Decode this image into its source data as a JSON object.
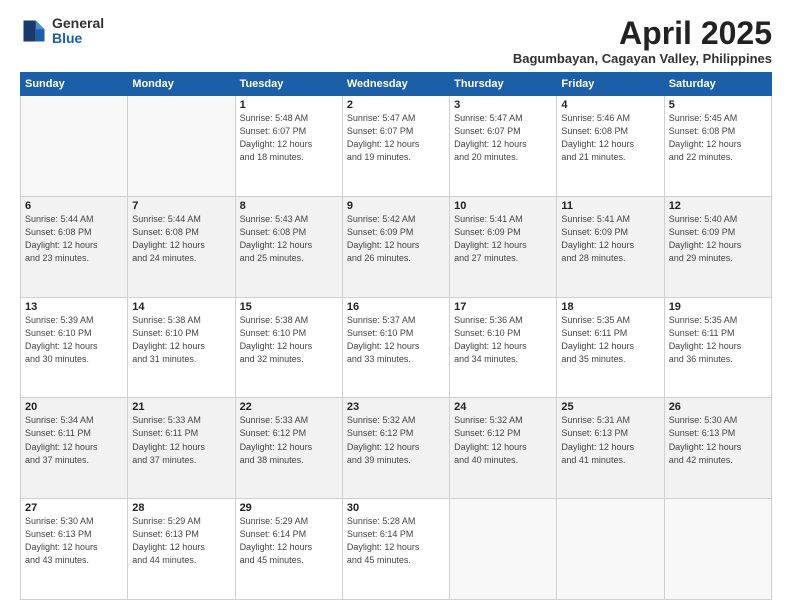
{
  "header": {
    "logo_general": "General",
    "logo_blue": "Blue",
    "main_title": "April 2025",
    "subtitle": "Bagumbayan, Cagayan Valley, Philippines"
  },
  "weekdays": [
    "Sunday",
    "Monday",
    "Tuesday",
    "Wednesday",
    "Thursday",
    "Friday",
    "Saturday"
  ],
  "weeks": [
    [
      {
        "day": "",
        "info": ""
      },
      {
        "day": "",
        "info": ""
      },
      {
        "day": "1",
        "info": "Sunrise: 5:48 AM\nSunset: 6:07 PM\nDaylight: 12 hours\nand 18 minutes."
      },
      {
        "day": "2",
        "info": "Sunrise: 5:47 AM\nSunset: 6:07 PM\nDaylight: 12 hours\nand 19 minutes."
      },
      {
        "day": "3",
        "info": "Sunrise: 5:47 AM\nSunset: 6:07 PM\nDaylight: 12 hours\nand 20 minutes."
      },
      {
        "day": "4",
        "info": "Sunrise: 5:46 AM\nSunset: 6:08 PM\nDaylight: 12 hours\nand 21 minutes."
      },
      {
        "day": "5",
        "info": "Sunrise: 5:45 AM\nSunset: 6:08 PM\nDaylight: 12 hours\nand 22 minutes."
      }
    ],
    [
      {
        "day": "6",
        "info": "Sunrise: 5:44 AM\nSunset: 6:08 PM\nDaylight: 12 hours\nand 23 minutes."
      },
      {
        "day": "7",
        "info": "Sunrise: 5:44 AM\nSunset: 6:08 PM\nDaylight: 12 hours\nand 24 minutes."
      },
      {
        "day": "8",
        "info": "Sunrise: 5:43 AM\nSunset: 6:08 PM\nDaylight: 12 hours\nand 25 minutes."
      },
      {
        "day": "9",
        "info": "Sunrise: 5:42 AM\nSunset: 6:09 PM\nDaylight: 12 hours\nand 26 minutes."
      },
      {
        "day": "10",
        "info": "Sunrise: 5:41 AM\nSunset: 6:09 PM\nDaylight: 12 hours\nand 27 minutes."
      },
      {
        "day": "11",
        "info": "Sunrise: 5:41 AM\nSunset: 6:09 PM\nDaylight: 12 hours\nand 28 minutes."
      },
      {
        "day": "12",
        "info": "Sunrise: 5:40 AM\nSunset: 6:09 PM\nDaylight: 12 hours\nand 29 minutes."
      }
    ],
    [
      {
        "day": "13",
        "info": "Sunrise: 5:39 AM\nSunset: 6:10 PM\nDaylight: 12 hours\nand 30 minutes."
      },
      {
        "day": "14",
        "info": "Sunrise: 5:38 AM\nSunset: 6:10 PM\nDaylight: 12 hours\nand 31 minutes."
      },
      {
        "day": "15",
        "info": "Sunrise: 5:38 AM\nSunset: 6:10 PM\nDaylight: 12 hours\nand 32 minutes."
      },
      {
        "day": "16",
        "info": "Sunrise: 5:37 AM\nSunset: 6:10 PM\nDaylight: 12 hours\nand 33 minutes."
      },
      {
        "day": "17",
        "info": "Sunrise: 5:36 AM\nSunset: 6:10 PM\nDaylight: 12 hours\nand 34 minutes."
      },
      {
        "day": "18",
        "info": "Sunrise: 5:35 AM\nSunset: 6:11 PM\nDaylight: 12 hours\nand 35 minutes."
      },
      {
        "day": "19",
        "info": "Sunrise: 5:35 AM\nSunset: 6:11 PM\nDaylight: 12 hours\nand 36 minutes."
      }
    ],
    [
      {
        "day": "20",
        "info": "Sunrise: 5:34 AM\nSunset: 6:11 PM\nDaylight: 12 hours\nand 37 minutes."
      },
      {
        "day": "21",
        "info": "Sunrise: 5:33 AM\nSunset: 6:11 PM\nDaylight: 12 hours\nand 37 minutes."
      },
      {
        "day": "22",
        "info": "Sunrise: 5:33 AM\nSunset: 6:12 PM\nDaylight: 12 hours\nand 38 minutes."
      },
      {
        "day": "23",
        "info": "Sunrise: 5:32 AM\nSunset: 6:12 PM\nDaylight: 12 hours\nand 39 minutes."
      },
      {
        "day": "24",
        "info": "Sunrise: 5:32 AM\nSunset: 6:12 PM\nDaylight: 12 hours\nand 40 minutes."
      },
      {
        "day": "25",
        "info": "Sunrise: 5:31 AM\nSunset: 6:13 PM\nDaylight: 12 hours\nand 41 minutes."
      },
      {
        "day": "26",
        "info": "Sunrise: 5:30 AM\nSunset: 6:13 PM\nDaylight: 12 hours\nand 42 minutes."
      }
    ],
    [
      {
        "day": "27",
        "info": "Sunrise: 5:30 AM\nSunset: 6:13 PM\nDaylight: 12 hours\nand 43 minutes."
      },
      {
        "day": "28",
        "info": "Sunrise: 5:29 AM\nSunset: 6:13 PM\nDaylight: 12 hours\nand 44 minutes."
      },
      {
        "day": "29",
        "info": "Sunrise: 5:29 AM\nSunset: 6:14 PM\nDaylight: 12 hours\nand 45 minutes."
      },
      {
        "day": "30",
        "info": "Sunrise: 5:28 AM\nSunset: 6:14 PM\nDaylight: 12 hours\nand 45 minutes."
      },
      {
        "day": "",
        "info": ""
      },
      {
        "day": "",
        "info": ""
      },
      {
        "day": "",
        "info": ""
      }
    ]
  ]
}
